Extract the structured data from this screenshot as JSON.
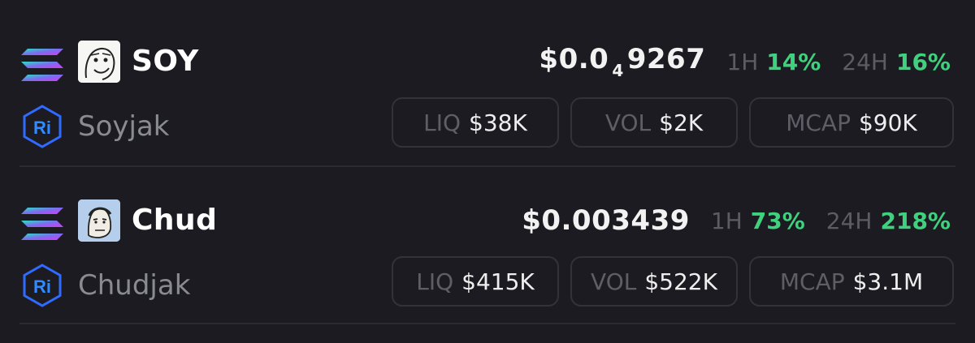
{
  "tokens": [
    {
      "symbol": "SOY",
      "name": "Soyjak",
      "price": {
        "prefix": "$0.0",
        "zeros": "4",
        "digits": "9267"
      },
      "change_1h": {
        "label": "1H",
        "value": "14%"
      },
      "change_24h": {
        "label": "24H",
        "value": "16%"
      },
      "liq": {
        "label": "LIQ",
        "value": "$38K"
      },
      "vol": {
        "label": "VOL",
        "value": "$2K"
      },
      "mcap": {
        "label": "MCAP",
        "value": "$90K"
      },
      "chain_icon": "solana-icon",
      "dex_icon": "raydium-icon",
      "avatar_icon": "soyjak-avatar"
    },
    {
      "symbol": "Chud",
      "name": "Chudjak",
      "price": {
        "value": "$0.003439"
      },
      "change_1h": {
        "label": "1H",
        "value": "73%"
      },
      "change_24h": {
        "label": "24H",
        "value": "218%"
      },
      "liq": {
        "label": "LIQ",
        "value": "$415K"
      },
      "vol": {
        "label": "VOL",
        "value": "$522K"
      },
      "mcap": {
        "label": "MCAP",
        "value": "$3.1M"
      },
      "chain_icon": "solana-icon",
      "dex_icon": "raydium-icon",
      "avatar_icon": "chudjak-avatar"
    }
  ],
  "colors": {
    "background": "#1c1b21",
    "positive": "#3fd17d",
    "muted_label": "#5d5c64",
    "pill_border": "#33323a",
    "dex_accent": "#2f6bff"
  }
}
